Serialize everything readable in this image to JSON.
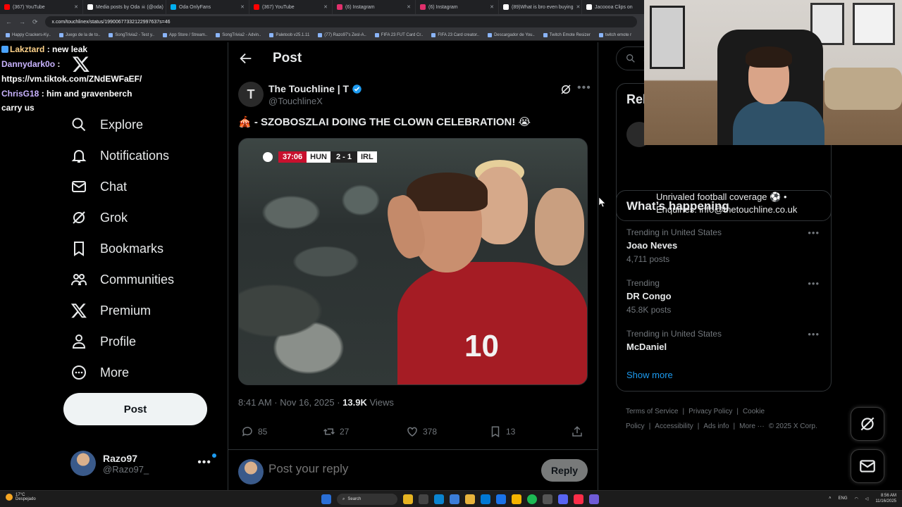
{
  "browser": {
    "tabs": [
      {
        "label": "(367) YouTube",
        "color": "#ff0000"
      },
      {
        "label": "Media posts by Oda ☠ (@oda)",
        "color": "#ffffff"
      },
      {
        "label": "Oda OnlyFans",
        "color": "#00aff0"
      },
      {
        "label": "(367) YouTube",
        "color": "#ff0000"
      },
      {
        "label": "(6) Instagram",
        "color": "#e1306c"
      },
      {
        "label": "(6) Instagram",
        "color": "#e1306c"
      },
      {
        "label": "(89)What is bro even buying",
        "color": "#ffffff"
      },
      {
        "label": "Jacoooa Clips on",
        "color": "#ffffff"
      }
    ],
    "url": "x.com/touchlinex/status/19900677332122997637s=46",
    "bookmarks": [
      "Happy Crackers-Ky..",
      "Juego de la de to..",
      "SongTrivia2 - Test y..",
      "App Store / Stream..",
      "SongTrivia2 - Advin..",
      "Paletoob v25.1.11",
      "(77) Razo97's Zesl-A..",
      "FIFA 23 FUT Card Cr..",
      "FIFA 23 Card creator..",
      "Descargador de You..",
      "Twitch Emote Resizer",
      "twitch emote r"
    ]
  },
  "chat": [
    {
      "user": "Lakztard",
      "message": "new leak"
    },
    {
      "user": "Dannydark0o",
      "message": "https://vm.tiktok.com/ZNdEWFaEF/"
    },
    {
      "user": "ChrisG18",
      "message": "him and gravenberch carry us"
    }
  ],
  "nav": {
    "items": [
      {
        "label": "Explore",
        "icon": "search-icon"
      },
      {
        "label": "Notifications",
        "icon": "bell-icon"
      },
      {
        "label": "Chat",
        "icon": "mail-icon"
      },
      {
        "label": "Grok",
        "icon": "grok-icon"
      },
      {
        "label": "Bookmarks",
        "icon": "bookmark-icon"
      },
      {
        "label": "Communities",
        "icon": "communities-icon"
      },
      {
        "label": "Premium",
        "icon": "x-logo-icon"
      },
      {
        "label": "Profile",
        "icon": "person-icon"
      },
      {
        "label": "More",
        "icon": "more-circle-icon"
      }
    ],
    "post_button": "Post",
    "account": {
      "name": "Razo97",
      "handle": "@Razo97_"
    }
  },
  "main": {
    "title": "Post",
    "tweet": {
      "author": "The Touchline | T",
      "handle": "@TouchlineX",
      "avatar_letter": "T",
      "text": "🎪 - SZOBOSZLAI DOING THE CLOWN CELEBRATION! 😭",
      "scorebug": {
        "time": "37:06",
        "home": "HUN",
        "score": "2 - 1",
        "away": "IRL"
      },
      "shirt_number": "10",
      "time": "8:41 AM · Nov 16, 2025 · ",
      "views_count": "13.9K",
      "views_label": " Views",
      "replies": "85",
      "reposts": "27",
      "likes": "378",
      "bookmarks": "13"
    },
    "reply_placeholder": "Post your reply",
    "reply_button": "Reply"
  },
  "right": {
    "search_placeholder": "S",
    "relevant_title": "Rel",
    "relevant_avatar_letter": "T",
    "bio_line1": "Unrivaled football coverage ⚽ •",
    "bio_line2": "Enquiries: info@thetouchline.co.uk",
    "happening_title": "What’s happening",
    "trends": [
      {
        "context": "Trending in United States",
        "topic": "Joao Neves",
        "count": "4,711 posts"
      },
      {
        "context": "Trending",
        "topic": "DR Congo",
        "count": "45.8K posts"
      },
      {
        "context": "Trending in United States",
        "topic": "McDaniel",
        "count": ""
      }
    ],
    "show_more": "Show more",
    "footer": [
      "Terms of Service",
      "|",
      "Privacy Policy",
      "|",
      "Cookie Policy",
      "|",
      "Accessibility",
      "|",
      "Ads info",
      "|",
      "More ···",
      "© 2025 X Corp."
    ]
  },
  "taskbar": {
    "temp": "17°C",
    "weather": "Despejado",
    "search": "Search",
    "lang": "ENG",
    "time": "8:56 AM",
    "date": "11/16/2025"
  },
  "colors": {
    "accent": "#1d9bf0",
    "background": "#000000",
    "text": "#e7e9ea",
    "muted": "#71767b"
  }
}
